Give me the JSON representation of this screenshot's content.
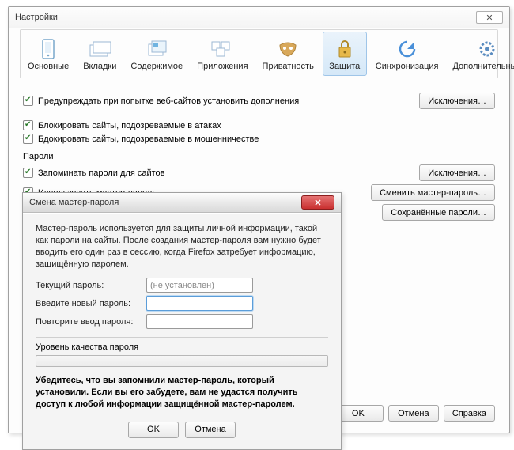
{
  "main": {
    "title": "Настройки",
    "close_glyph": "✕",
    "tabs": [
      {
        "label": "Основные"
      },
      {
        "label": "Вкладки"
      },
      {
        "label": "Содержимое"
      },
      {
        "label": "Приложения"
      },
      {
        "label": "Приватность"
      },
      {
        "label": "Защита"
      },
      {
        "label": "Синхронизация"
      },
      {
        "label": "Дополнительные"
      }
    ],
    "addons": {
      "warn_install": "Предупреждать при попытке веб-сайтов установить дополнения",
      "exceptions_btn": "Исключения…",
      "block_attack": "Блокировать сайты, подозреваемые в атаках",
      "block_fraud": "Бдокировать сайты, подозреваемые в мошенничестве"
    },
    "passwords": {
      "section": "Пароли",
      "remember": "Запоминать пароли для сайтов",
      "use_master": "Использовать мастер-пароль",
      "exceptions_btn": "Исключения…",
      "change_master_btn": "Сменить мастер-пароль…",
      "saved_btn": "Сохранённые пароли…"
    },
    "footer": {
      "ok": "OK",
      "cancel": "Отмена",
      "help": "Справка"
    }
  },
  "dialog": {
    "title": "Смена мастер-пароля",
    "desc": "Мастер-пароль используется для защиты личной информации, такой как пароли на сайты. После создания мастер-пароля вам нужно будет вводить его один раз в сессию, когда Firefox затребует информацию, защищённую паролем.",
    "current_label": "Текущий пароль:",
    "current_placeholder": "(не установлен)",
    "new_label": "Введите новый пароль:",
    "repeat_label": "Повторите ввод пароля:",
    "quality_label": "Уровень качества пароля",
    "warning": "Убедитесь, что вы запомнили мастер-пароль, который установили. Если вы его забудете, вам не удастся получить доступ к любой информации защищённой мастер-паролем.",
    "ok": "OK",
    "cancel": "Отмена"
  }
}
